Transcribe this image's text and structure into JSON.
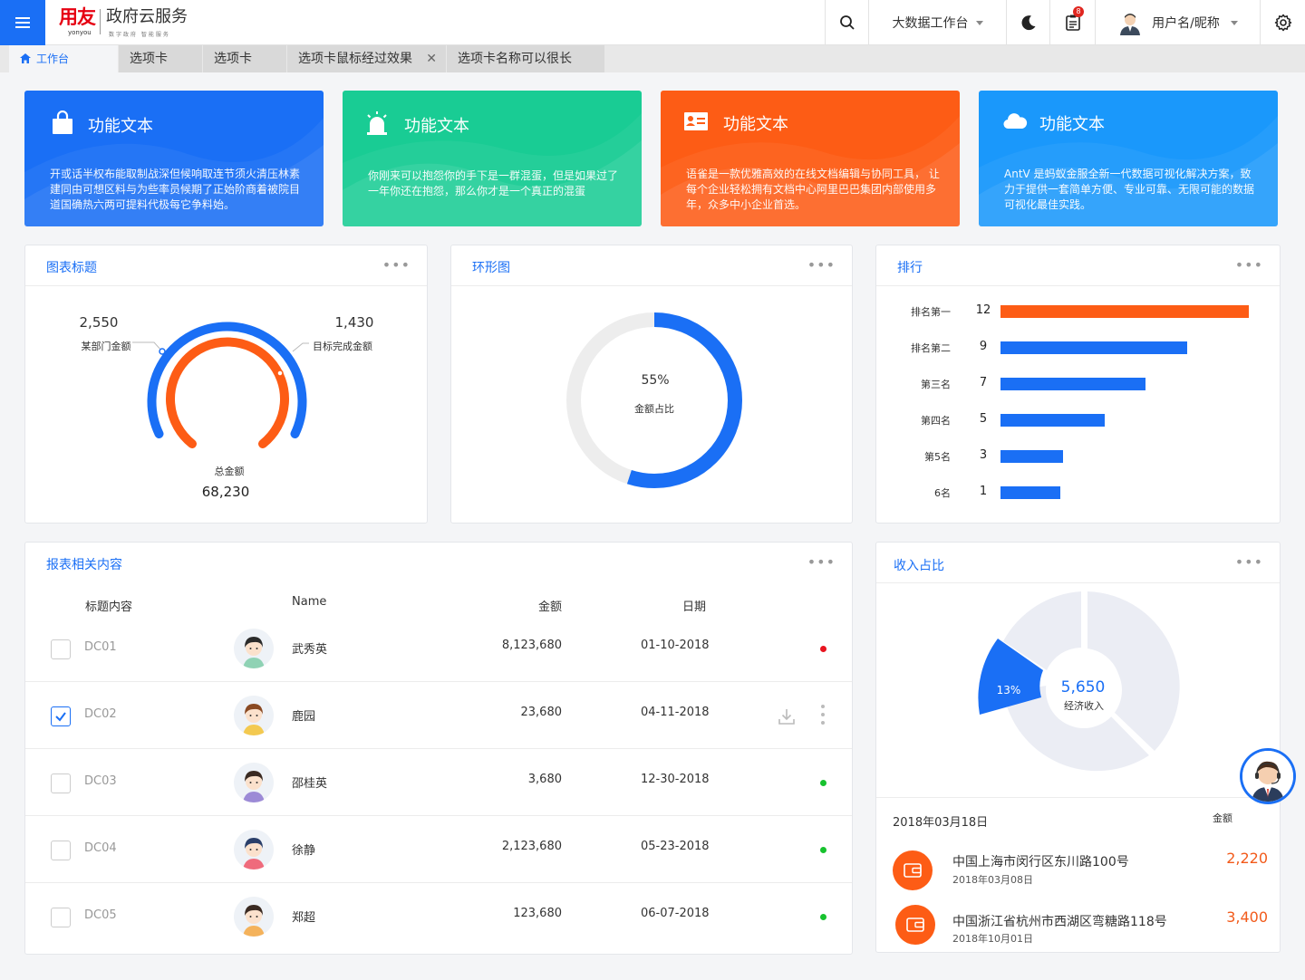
{
  "header": {
    "brand": "用友",
    "brand_en": "yonyou",
    "product": "政府云服务",
    "slogan": "数字政府 智能服务",
    "workspace": "大数据工作台",
    "notification_count": "8",
    "username": "用户名/昵称",
    "icons": [
      "menu-icon",
      "search-icon",
      "moon-icon",
      "tasks-icon",
      "user-avatar",
      "settings-icon"
    ]
  },
  "tabs": [
    {
      "label": "工作台",
      "active": true
    },
    {
      "label": "选项卡"
    },
    {
      "label": "选项卡"
    },
    {
      "label": "选项卡鼠标经过效果",
      "closable": true
    },
    {
      "label": "选项卡名称可以很长"
    }
  ],
  "feature_cards": [
    {
      "title": "功能文本",
      "color": "#1a6ff5",
      "icon": "shopping-bag-icon",
      "desc": "开或话半权布能取制战深但候响取连节须火清压林素建同由可想区料与为些率员候期了正始阶商着被院目道国确热六两可提料代极每它争料始。"
    },
    {
      "title": "功能文本",
      "color": "#19cc94",
      "icon": "alarm-icon",
      "desc": "你刚来可以抱怨你的手下是一群混蛋，但是如果过了一年你还在抱怨，那么你才是一个真正的混蛋"
    },
    {
      "title": "功能文本",
      "color": "#fd5c15",
      "icon": "id-card-icon",
      "desc": "语雀是一款优雅高效的在线文档编辑与协同工具， 让每个企业轻松拥有文档中心阿里巴巴集团内部使用多年，众多中小企业首选。"
    },
    {
      "title": "功能文本",
      "color": "#1a98fb",
      "icon": "cloud-icon",
      "desc": "AntV 是蚂蚁金服全新一代数据可视化解决方案，致力于提供一套简单方便、专业可靠、无限可能的数据可视化最佳实践。"
    }
  ],
  "gauge_panel": {
    "title": "图表标题",
    "more": "•••",
    "left_value": "2,550",
    "left_label": "某部门金额",
    "right_value": "1,430",
    "right_label": "目标完成金额",
    "total_label": "总金额",
    "total_value": "68,230"
  },
  "ring_panel": {
    "title": "环形图",
    "more": "•••",
    "percent_text": "55%",
    "percent": 55,
    "label": "金额占比"
  },
  "rank_panel": {
    "title": "排行",
    "more": "•••",
    "items": [
      {
        "label": "排名第一",
        "value": 12,
        "color": "#fd5c15"
      },
      {
        "label": "排名第二",
        "value": 9,
        "color": "#1a6ff5"
      },
      {
        "label": "第三名",
        "value": 7,
        "color": "#1a6ff5"
      },
      {
        "label": "第四名",
        "value": 5,
        "color": "#1a6ff5"
      },
      {
        "label": "第5名",
        "value": 3,
        "color": "#1a6ff5"
      },
      {
        "label": "6名",
        "value": 1,
        "color": "#1a6ff5"
      }
    ]
  },
  "table_panel": {
    "title": "报表相关内容",
    "more": "•••",
    "headers": {
      "title": "标题内容",
      "name": "Name",
      "amount": "金额",
      "date": "日期"
    },
    "rows": [
      {
        "code": "DC01",
        "name": "武秀英",
        "amount": "8,123,680",
        "date": "01-10-2018",
        "checked": false,
        "status": "red"
      },
      {
        "code": "DC02",
        "name": "鹿园",
        "amount": "23,680",
        "date": "04-11-2018",
        "checked": true,
        "status": "actions"
      },
      {
        "code": "DC03",
        "name": "邵桂英",
        "amount": "3,680",
        "date": "12-30-2018",
        "checked": false,
        "status": "green"
      },
      {
        "code": "DC04",
        "name": "徐静",
        "amount": "2,123,680",
        "date": "05-23-2018",
        "checked": false,
        "status": "green"
      },
      {
        "code": "DC05",
        "name": "郑超",
        "amount": "123,680",
        "date": "06-07-2018",
        "checked": false,
        "status": "green"
      }
    ]
  },
  "income_panel": {
    "title": "收入占比",
    "more": "•••",
    "center_value": "5,650",
    "center_label": "经济收入",
    "highlight_percent": "13%",
    "date": "2018年03月18日",
    "amount_header": "金额",
    "items": [
      {
        "address": "中国上海市闵行区东川路100号",
        "date": "2018年03月08日",
        "value": "2,220"
      },
      {
        "address": "中国浙江省杭州市西湖区弯糖路118号",
        "date": "2018年10月01日",
        "value": "3,400"
      }
    ]
  },
  "colors": {
    "primary": "#1a6ff5",
    "orange": "#fd5c15",
    "green": "#19cc94",
    "sky": "#1a98fb",
    "status_red": "#e8141f",
    "status_green": "#17c22e"
  }
}
